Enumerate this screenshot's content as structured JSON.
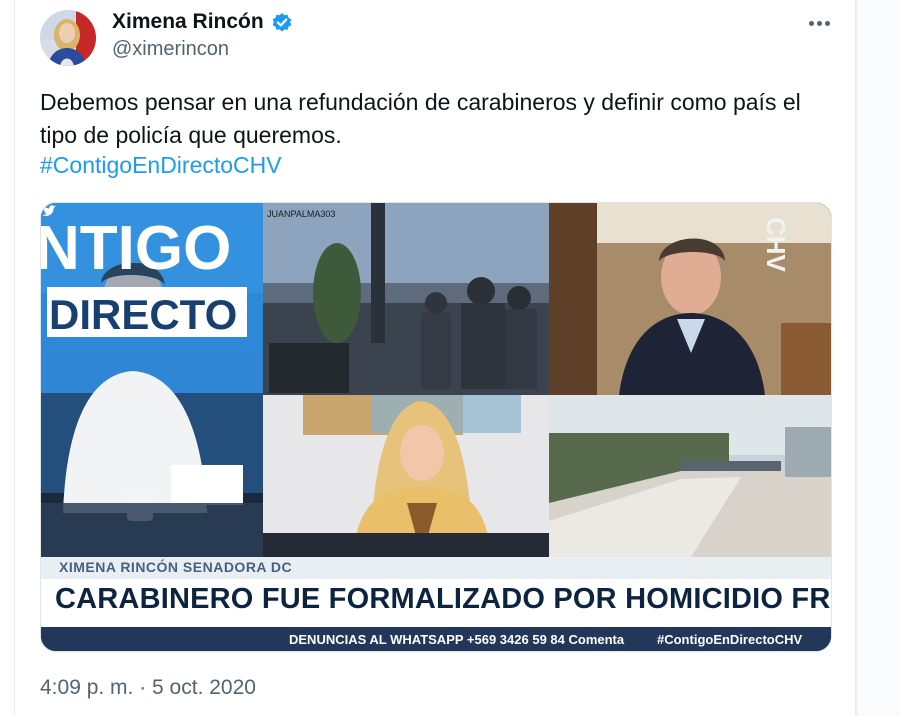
{
  "author": {
    "display_name": "Ximena Rincón",
    "handle": "@ximerincon",
    "verified": true,
    "avatar_icon": "profile-photo"
  },
  "tweet": {
    "text": "Debemos pensar en una refundación de carabineros y definir como país el tipo de policía que queremos.",
    "hashtag": "#ContigoEnDirectoCHV",
    "timestamp": "4:09 p. m. · 5 oct. 2020"
  },
  "media": {
    "show_logo_top": "NTIGO",
    "show_logo_bottom": "DIRECTO",
    "watermark": "JUANPALMA303",
    "channel_mark": "CHV",
    "lower_third_name": "XIMENA RINCÓN SENADORA DC",
    "headline": "CARABINERO FUE FORMALIZADO POR HOMICIDIO FRUSTADO",
    "ticker_text": "DENUNCIAS AL WHATSAPP +569 3426 59 84  Comenta",
    "ticker_hashtag": "#ContigoEnDirectoCHV"
  },
  "colors": {
    "link_blue": "#1d9bf0",
    "verified_blue": "#1d9bf0",
    "secondary_text": "#536471",
    "headline_navy": "#0d2440"
  }
}
